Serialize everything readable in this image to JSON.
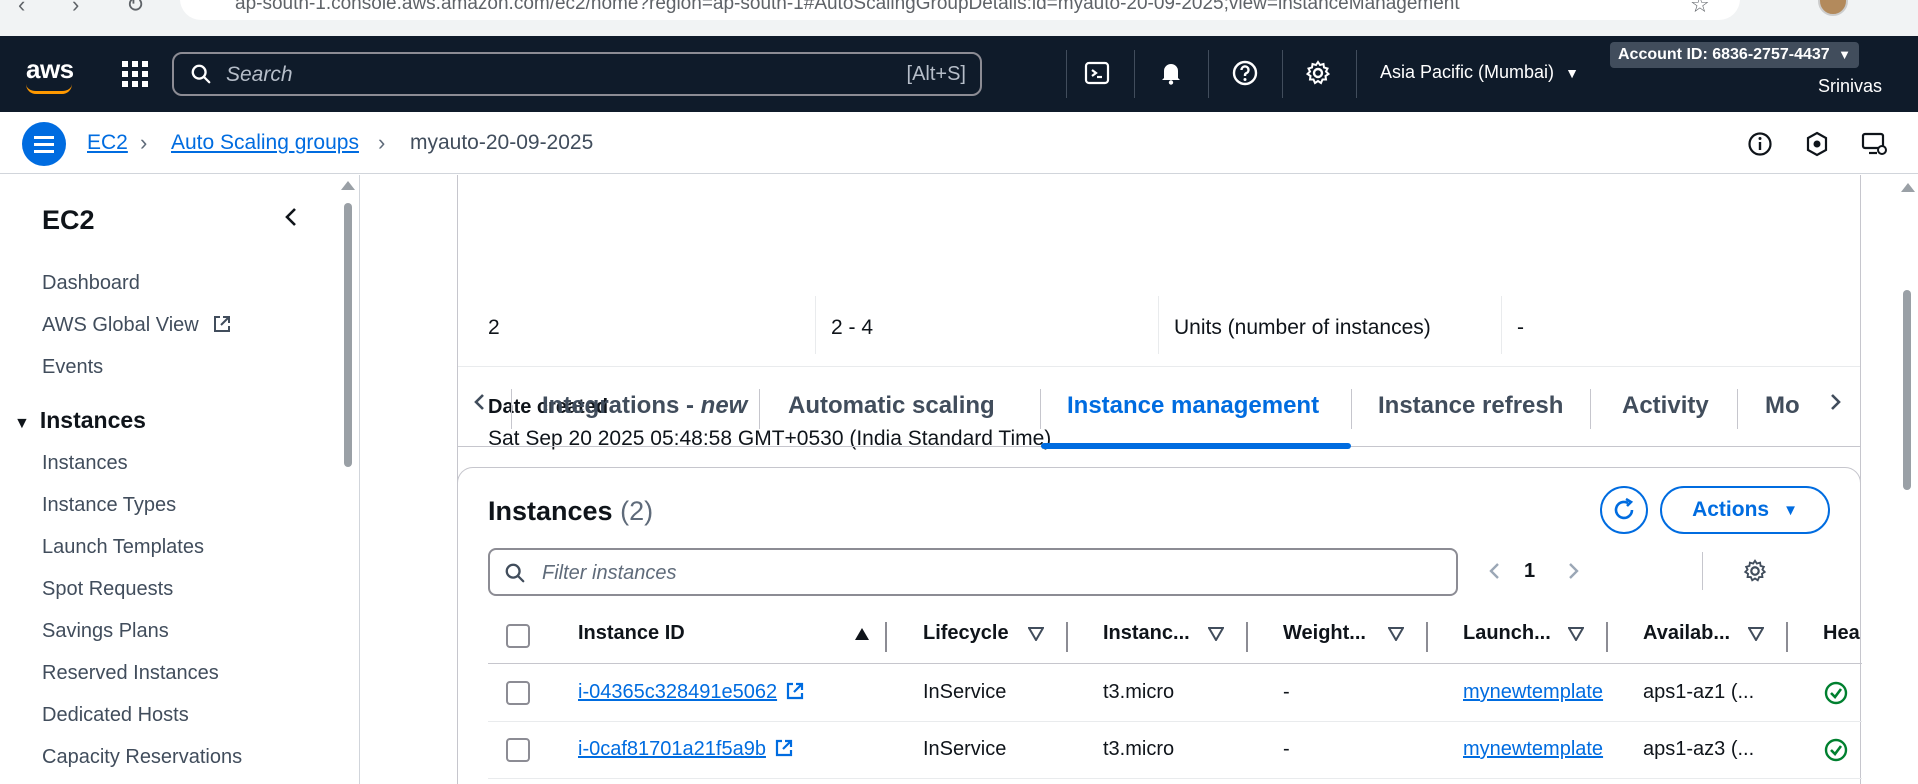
{
  "browser": {
    "url": "ap-south-1.console.aws.amazon.com/ec2/home?region=ap-south-1#AutoScalingGroupDetails:id=myauto-20-09-2025;view=instanceManagement"
  },
  "topnav": {
    "logo": "aws",
    "search_placeholder": "Search",
    "search_shortcut": "[Alt+S]",
    "region": "Asia Pacific (Mumbai)",
    "account": "Account ID: 6836-2757-4437",
    "user": "Srinivas"
  },
  "breadcrumb": {
    "items": [
      "EC2",
      "Auto Scaling groups"
    ],
    "current": "myauto-20-09-2025"
  },
  "sidebar": {
    "title": "EC2",
    "top_items": [
      "Dashboard",
      "AWS Global View",
      "Events"
    ],
    "section": "Instances",
    "section_items": [
      "Instances",
      "Instance Types",
      "Launch Templates",
      "Spot Requests",
      "Savings Plans",
      "Reserved Instances",
      "Dedicated Hosts",
      "Capacity Reservations"
    ]
  },
  "details": {
    "row_values": [
      "2",
      "2 - 4",
      "Units (number of instances)",
      "-"
    ],
    "date_label": "Date created",
    "date_value": "Sat Sep 20 2025 05:48:58 GMT+0530 (India Standard Time)"
  },
  "tabs": {
    "integrations_prefix": "Integrations - ",
    "integrations_suffix": "new",
    "items": [
      "Automatic scaling",
      "Instance management",
      "Instance refresh",
      "Activity",
      "Mo"
    ],
    "active": "Instance management"
  },
  "instances": {
    "title": "Instances",
    "count": "(2)",
    "actions_label": "Actions",
    "filter_placeholder": "Filter instances",
    "page": "1",
    "columns": [
      "Instance ID",
      "Lifecycle",
      "Instanc...",
      "Weight...",
      "Launch...",
      "Availab...",
      "Hea"
    ],
    "rows": [
      {
        "id": "i-04365c328491e5062",
        "lifecycle": "InService",
        "type": "t3.micro",
        "weight": "-",
        "launch": "mynewtemplate",
        "az": "aps1-az1 (...",
        "health": "healthy"
      },
      {
        "id": "i-0caf81701a21f5a9b",
        "lifecycle": "InService",
        "type": "t3.micro",
        "weight": "-",
        "launch": "mynewtemplate",
        "az": "aps1-az3 (...",
        "health": "healthy"
      }
    ]
  },
  "colors": {
    "nav_bg": "#0f1b2a",
    "link": "#006ce0",
    "success": "#00802f",
    "text": "#0f141a"
  }
}
